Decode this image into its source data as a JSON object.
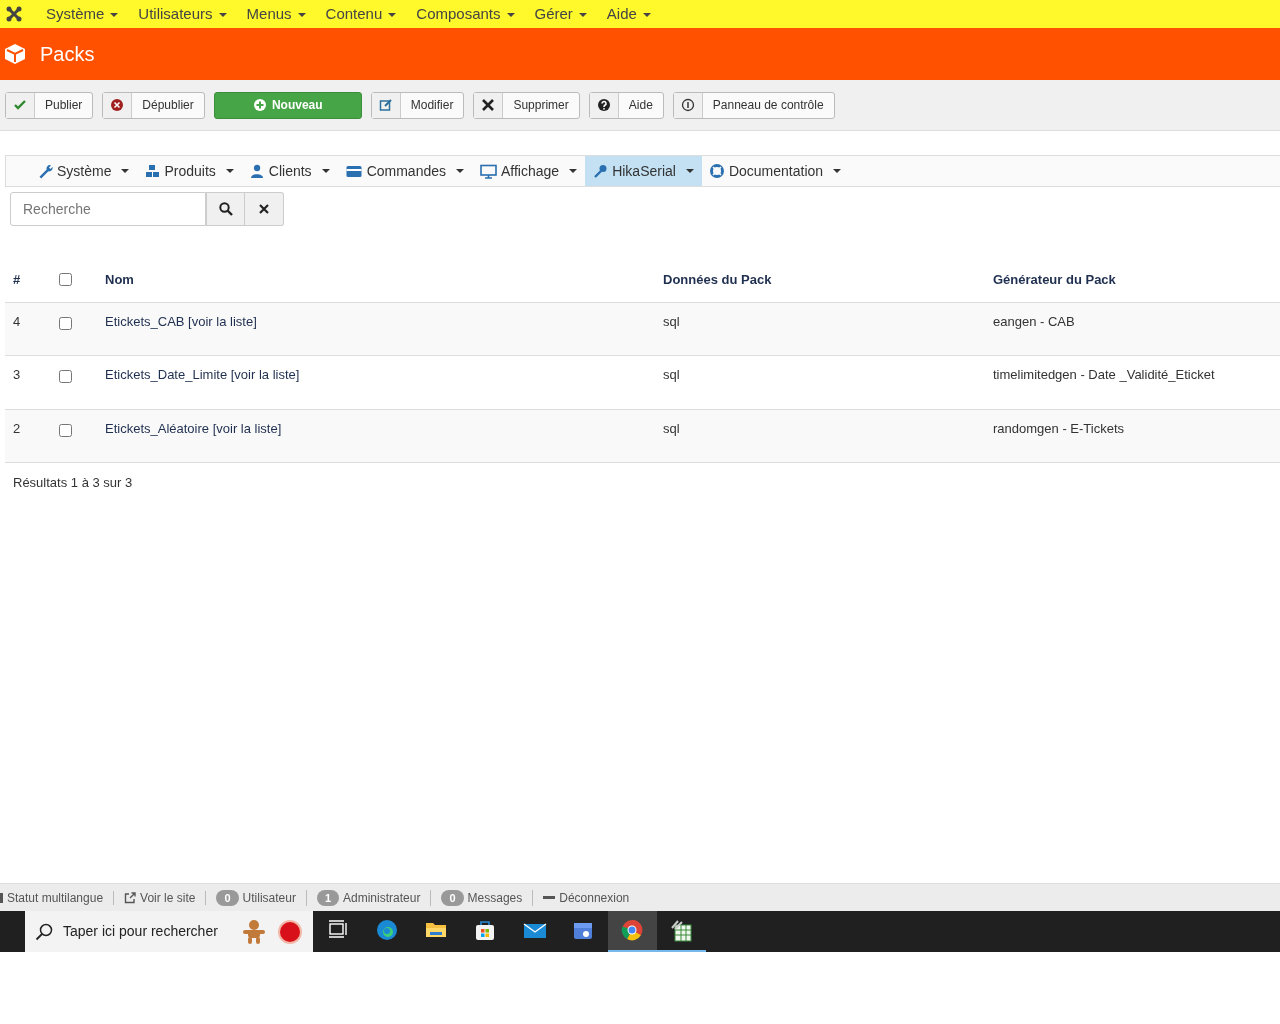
{
  "top_menu": [
    {
      "label": "Système"
    },
    {
      "label": "Utilisateurs"
    },
    {
      "label": "Menus"
    },
    {
      "label": "Contenu"
    },
    {
      "label": "Composants"
    },
    {
      "label": "Gérer"
    },
    {
      "label": "Aide"
    }
  ],
  "header": {
    "title": "Packs"
  },
  "toolbar": [
    {
      "kind": "publish",
      "label": "Publier"
    },
    {
      "kind": "unpublish",
      "label": "Dépublier"
    },
    {
      "kind": "new",
      "label": "Nouveau"
    },
    {
      "kind": "edit",
      "label": "Modifier"
    },
    {
      "kind": "delete",
      "label": "Supprimer"
    },
    {
      "kind": "help",
      "label": "Aide"
    },
    {
      "kind": "dashboard",
      "label": "Panneau de contrôle"
    }
  ],
  "submenu": [
    {
      "kind": "wrench",
      "label": "Système",
      "selected": false
    },
    {
      "kind": "cubes",
      "label": "Produits",
      "selected": false
    },
    {
      "kind": "user",
      "label": "Clients",
      "selected": false
    },
    {
      "kind": "card",
      "label": "Commandes",
      "selected": false
    },
    {
      "kind": "monitor",
      "label": "Affichage",
      "selected": false
    },
    {
      "kind": "key",
      "label": "HikaSerial",
      "selected": true
    },
    {
      "kind": "lifebuoy",
      "label": "Documentation",
      "selected": false
    }
  ],
  "search": {
    "placeholder": "Recherche"
  },
  "table": {
    "columns": [
      "#",
      "Nom",
      "Données du Pack",
      "Générateur du Pack"
    ],
    "select_all_checked": false,
    "rows": [
      {
        "id": "4",
        "checked": false,
        "name": "Etickets_CAB",
        "link": "[voir la liste]",
        "data": "sql",
        "generator": "eangen - CAB"
      },
      {
        "id": "3",
        "checked": false,
        "name": "Etickets_Date_Limite",
        "link": "[voir la liste]",
        "data": "sql",
        "generator": "timelimitedgen - Date _Validité_Eticket"
      },
      {
        "id": "2",
        "checked": false,
        "name": "Etickets_Aléatoire",
        "link": "[voir la liste]",
        "data": "sql",
        "generator": "randomgen - E-Tickets"
      }
    ]
  },
  "results": "Résultats 1 à 3 sur 3",
  "status_bar": [
    {
      "kind": "plain",
      "label": "Statut multilangue"
    },
    {
      "kind": "external",
      "label": "Voir le site"
    },
    {
      "kind": "count",
      "count": "0",
      "label": "Utilisateur"
    },
    {
      "kind": "count",
      "count": "1",
      "label": "Administrateur"
    },
    {
      "kind": "count",
      "count": "0",
      "label": "Messages"
    },
    {
      "kind": "logout",
      "label": "Déconnexion"
    }
  ],
  "taskbar": {
    "search_placeholder": "Taper ici pour rechercher",
    "apps": [
      {
        "kind": "taskview",
        "selected": false,
        "open": false
      },
      {
        "kind": "edge",
        "selected": false,
        "open": false
      },
      {
        "kind": "folder",
        "selected": false,
        "open": false
      },
      {
        "kind": "store",
        "selected": false,
        "open": false
      },
      {
        "kind": "mail",
        "selected": false,
        "open": false
      },
      {
        "kind": "mybusiness",
        "selected": false,
        "open": false
      },
      {
        "kind": "chrome",
        "selected": true,
        "open": true
      },
      {
        "kind": "spreadsheet",
        "selected": false,
        "open": true
      }
    ]
  }
}
